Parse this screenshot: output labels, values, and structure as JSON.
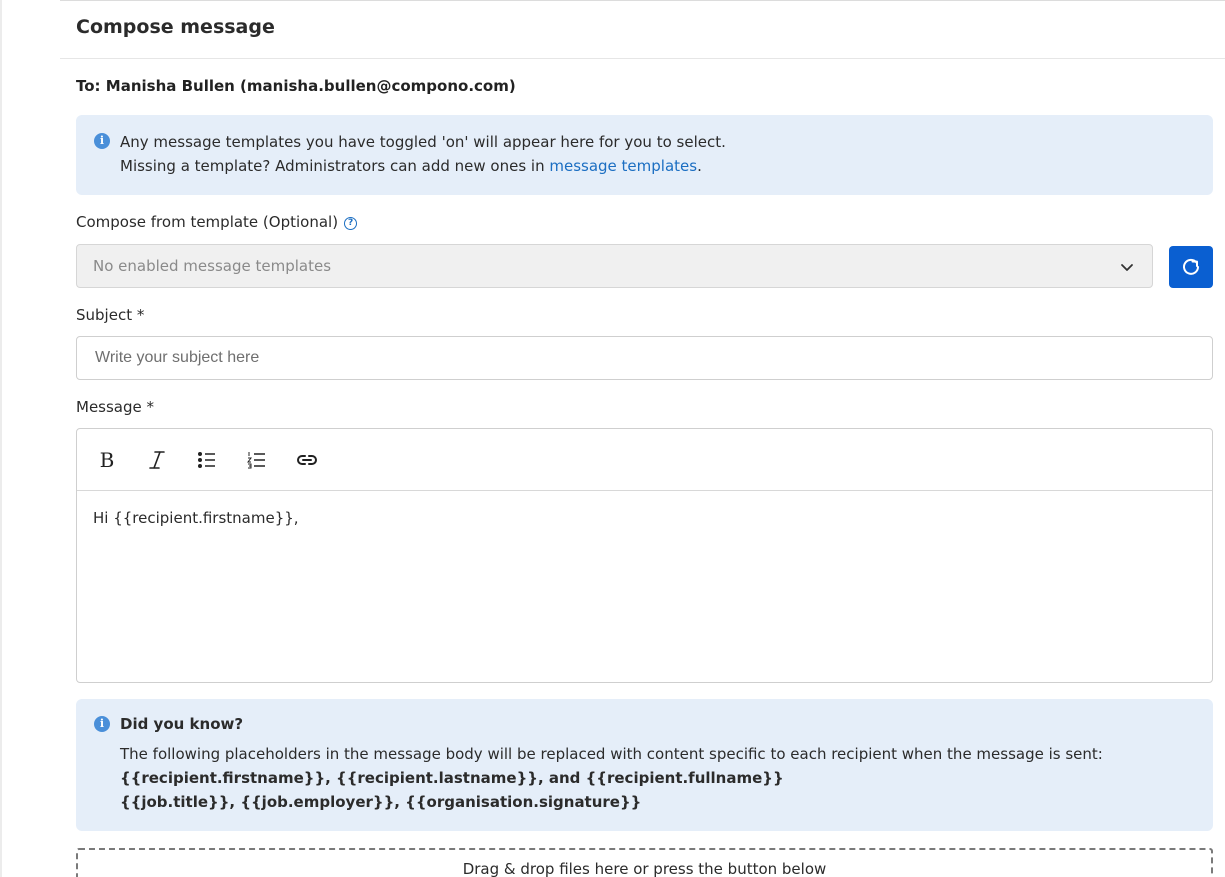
{
  "modal": {
    "title": "Compose message"
  },
  "recipient": {
    "line": "To: Manisha Bullen (manisha.bullen@compono.com)"
  },
  "template_info": {
    "line1": "Any message templates you have toggled 'on' will appear here for you to select.",
    "line2_prefix": "Missing a template? Administrators can add new ones in ",
    "line2_link": "message templates",
    "line2_suffix": "."
  },
  "template_select": {
    "label": "Compose from template (Optional)",
    "value": "No enabled message templates"
  },
  "subject": {
    "label": "Subject *",
    "placeholder": "Write your subject here"
  },
  "message": {
    "label": "Message *",
    "toolbar": [
      "bold-icon",
      "italic-icon",
      "bullet-list-icon",
      "numbered-list-icon",
      "link-icon"
    ],
    "body": "Hi {{recipient.firstname}},"
  },
  "tip": {
    "title": "Did you know?",
    "text": "The following placeholders in the message body will be replaced with content specific to each recipient when the message is sent:",
    "placeholders_line1": "{{recipient.firstname}}, {{recipient.lastname}}, and {{recipient.fullname}}",
    "placeholders_line2": "{{job.title}}, {{job.employer}}, {{organisation.signature}}"
  },
  "dropzone": {
    "text": "Drag & drop files here or press the button below"
  },
  "colors": {
    "accent": "#0a5fd1",
    "link": "#1b6ec2",
    "info_bg": "#e5eef9"
  }
}
